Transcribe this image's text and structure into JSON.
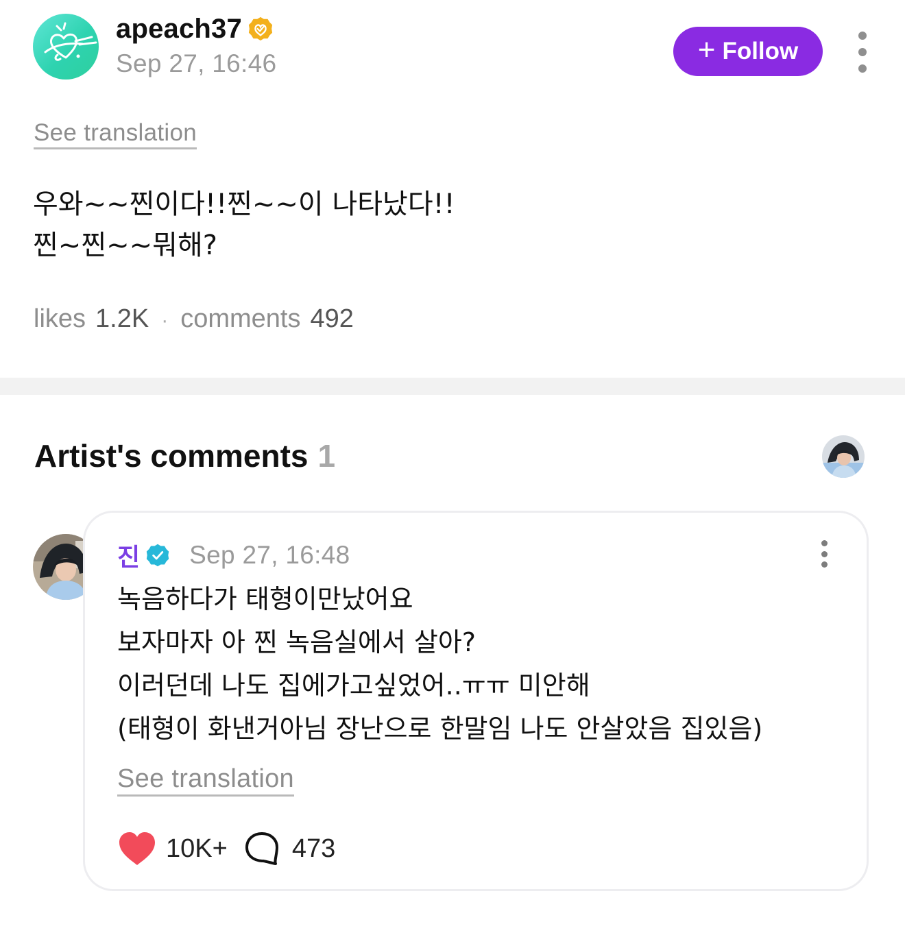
{
  "post": {
    "author": {
      "username": "apeach37",
      "avatar_icon": "apeach-heart-logo-icon",
      "badge_icon": "gold-verified-badge-icon",
      "avatar_color": "#2fd6b4"
    },
    "date": "Sep 27, 16:46",
    "follow_button": {
      "icon": "+",
      "label": "Follow",
      "color": "#8a2be2"
    },
    "more_icon": "more-vertical-icon",
    "see_translation": "See translation",
    "text_lines": [
      "우와~~찐이다!!찐~~이 나타났다!!",
      "찐~찐~~뭐해?"
    ],
    "stats": {
      "likes_label": "likes",
      "likes_value": "1.2K",
      "separator": "·",
      "comments_label": "comments",
      "comments_value": "492"
    }
  },
  "artist_comments": {
    "title": "Artist's comments",
    "count": "1",
    "header_avatar_icon": "artist-avatar-icon",
    "comment": {
      "author": "진",
      "author_color": "#7b3fe4",
      "badge_icon": "blue-verified-badge-icon",
      "date": "Sep 27, 16:48",
      "more_icon": "more-vertical-icon",
      "text_lines": [
        "녹음하다가 태형이만났어요",
        "보자마자 아 찐 녹음실에서 살아?",
        "이러던데 나도 집에가고싶었어..ㅠㅠ 미안해",
        "(태형이 화낸거아님 장난으로 한말임 나도 안살았음 집있음)"
      ],
      "see_translation": "See translation",
      "likes": "10K+",
      "replies": "473",
      "heart_color": "#f24b5a"
    }
  }
}
